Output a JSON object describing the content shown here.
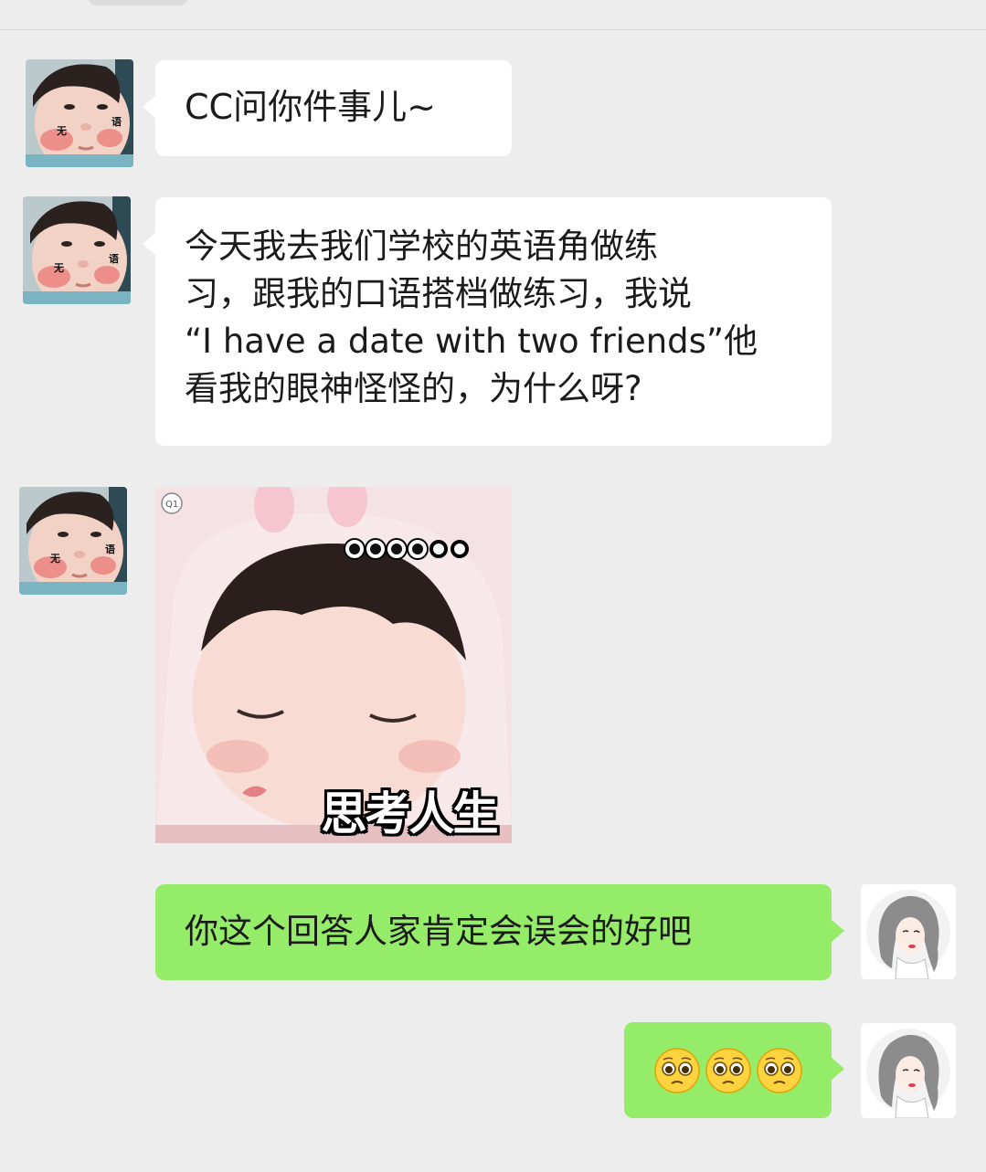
{
  "messages": [
    {
      "side": "left",
      "type": "text",
      "text": "CC问你件事儿~"
    },
    {
      "side": "left",
      "type": "text",
      "text": "今天我去我们学校的英语角做练\n习，跟我的口语搭档做练习，我说\n“I have a date with two friends”他\n看我的眼神怪怪的，为什么呀?"
    },
    {
      "side": "left",
      "type": "sticker",
      "caption": "思考人生"
    },
    {
      "side": "right",
      "type": "text",
      "text": "你这个回答人家肯定会误会的好吧"
    },
    {
      "side": "right",
      "type": "emoji",
      "emoji_name": "pleading-face",
      "count": 3
    }
  ],
  "sticker": {
    "caption": "思考人生",
    "badge": "Q1"
  },
  "avatars": {
    "left_badge_1": "无",
    "left_badge_2": "语"
  },
  "colors": {
    "background": "#ededed",
    "incoming_bubble": "#ffffff",
    "outgoing_bubble": "#95ec69"
  }
}
